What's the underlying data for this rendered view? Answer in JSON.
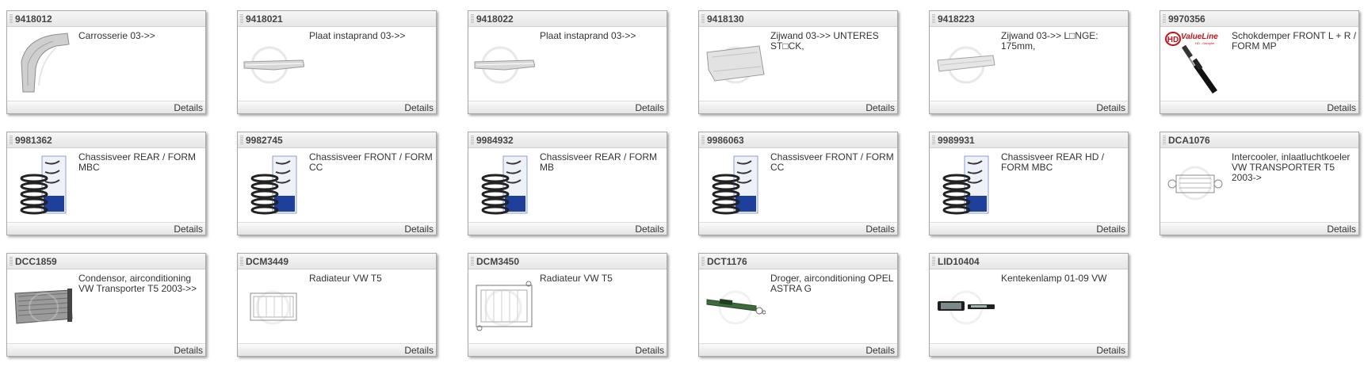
{
  "details_label": "Details",
  "items": [
    {
      "code": "9418012",
      "desc": "Carrosserie 03->>",
      "icon": "body-panel-icon"
    },
    {
      "code": "9418021",
      "desc": "Plaat instaprand 03->>",
      "icon": "sill-plate-icon"
    },
    {
      "code": "9418022",
      "desc": "Plaat instaprand 03->>",
      "icon": "sill-plate-icon"
    },
    {
      "code": "9418130",
      "desc": "Zijwand 03->> UNTERES ST□CK,",
      "icon": "side-panel-icon"
    },
    {
      "code": "9418223",
      "desc": "Zijwand 03->> L□NGE: 175mm,",
      "icon": "side-panel-icon"
    },
    {
      "code": "9970356",
      "desc": "Schokdemper FRONT L + R / FORM MP",
      "icon": "shock-absorber-icon",
      "brand": "ValueLine",
      "brand_sub": "HD - Dämpfer"
    },
    {
      "code": "9981362",
      "desc": "Chassisveer REAR / FORM MBC",
      "icon": "coil-spring-icon"
    },
    {
      "code": "9982745",
      "desc": "Chassisveer FRONT / FORM CC",
      "icon": "coil-spring-icon"
    },
    {
      "code": "9984932",
      "desc": "Chassisveer REAR / FORM MB",
      "icon": "coil-spring-icon"
    },
    {
      "code": "9986063",
      "desc": "Chassisveer FRONT / FORM CC",
      "icon": "coil-spring-icon"
    },
    {
      "code": "9989931",
      "desc": "Chassisveer REAR HD / FORM MBC",
      "icon": "coil-spring-icon"
    },
    {
      "code": "DCA1076",
      "desc": "Intercooler, inlaatluchtkoeler VW TRANSPORTER T5 2003->",
      "icon": "intercooler-icon"
    },
    {
      "code": "DCC1859",
      "desc": "Condensor, airconditioning VW Transporter T5 2003->>",
      "icon": "condenser-icon"
    },
    {
      "code": "DCM3449",
      "desc": "Radiateur VW T5",
      "icon": "radiator-icon"
    },
    {
      "code": "DCM3450",
      "desc": "Radiateur VW T5",
      "icon": "radiator-icon"
    },
    {
      "code": "DCT1176",
      "desc": "Droger, airconditioning OPEL ASTRA G",
      "icon": "dryer-icon"
    },
    {
      "code": "LID10404",
      "desc": "Kentekenlamp 01-09 VW",
      "icon": "license-lamp-icon"
    }
  ]
}
